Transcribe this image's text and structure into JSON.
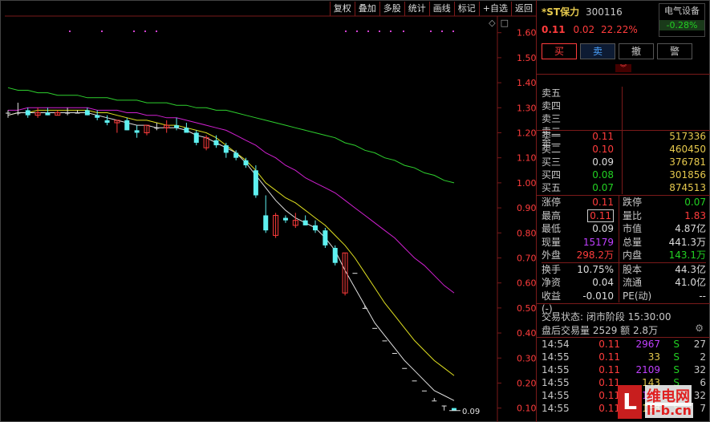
{
  "toolbar": {
    "buttons": [
      "复权",
      "叠加",
      "多股",
      "统计",
      "画线",
      "标记",
      "+自选",
      "返回"
    ],
    "icons": [
      "◇",
      "□"
    ]
  },
  "stock": {
    "name": "*ST保力",
    "code": "300116",
    "price": "0.11",
    "change": "0.02",
    "change_pct": "22.22%",
    "sector": "电气设备",
    "sector_pct": "-0.28%"
  },
  "trade_buttons": [
    "买",
    "卖",
    "撤",
    "警"
  ],
  "orderbook": {
    "sell": [
      {
        "label": "卖五",
        "price": "",
        "vol": ""
      },
      {
        "label": "卖四",
        "price": "",
        "vol": ""
      },
      {
        "label": "卖三",
        "price": "",
        "vol": ""
      },
      {
        "label": "卖二",
        "price": "",
        "vol": ""
      },
      {
        "label": "卖一",
        "price": "",
        "vol": ""
      }
    ],
    "buy": [
      {
        "label": "买一",
        "price": "0.11",
        "vol": "517336",
        "color": "red"
      },
      {
        "label": "买二",
        "price": "0.10",
        "vol": "460450",
        "color": "red"
      },
      {
        "label": "买三",
        "price": "0.09",
        "vol": "376781",
        "color": "white"
      },
      {
        "label": "买四",
        "price": "0.08",
        "vol": "301856",
        "color": "green"
      },
      {
        "label": "买五",
        "price": "0.07",
        "vol": "874513",
        "color": "green"
      }
    ]
  },
  "stats": [
    {
      "l1": "涨停",
      "v1": "0.11",
      "c1": "red",
      "l2": "跌停",
      "v2": "0.07",
      "c2": "green"
    },
    {
      "l1": "最高",
      "v1": "0.11",
      "c1": "red",
      "boxed": true,
      "l2": "量比",
      "v2": "1.83",
      "c2": "red"
    },
    {
      "l1": "最低",
      "v1": "0.09",
      "c1": "white",
      "l2": "市值",
      "v2": "4.87亿",
      "c2": "white"
    },
    {
      "l1": "现量",
      "v1": "15179",
      "c1": "purple",
      "l2": "总量",
      "v2": "441.3万",
      "c2": "white"
    },
    {
      "l1": "外盘",
      "v1": "298.2万",
      "c1": "red",
      "l2": "内盘",
      "v2": "143.1万",
      "c2": "green"
    },
    {
      "l1": "换手",
      "v1": "10.75%",
      "c1": "white",
      "l2": "股本",
      "v2": "44.3亿",
      "c2": "white"
    },
    {
      "l1": "净资",
      "v1": "0.04",
      "c1": "white",
      "l2": "流通",
      "v2": "41.0亿",
      "c2": "white"
    },
    {
      "l1": "收益(-)",
      "v1": "-0.010",
      "c1": "white",
      "l2": "PE(动)",
      "v2": "--",
      "c2": "white"
    }
  ],
  "status": {
    "line1": "交易状态: 闭市阶段 15:30:00",
    "line2": "盘后交易量 2529 额 2.8万"
  },
  "ticks": [
    {
      "t": "14:54",
      "p": "0.11",
      "v": "2967",
      "vc": "purple",
      "s": "S",
      "n": "27"
    },
    {
      "t": "14:55",
      "p": "0.11",
      "v": "33",
      "vc": "yellow",
      "s": "S",
      "n": "2"
    },
    {
      "t": "14:55",
      "p": "0.11",
      "v": "2109",
      "vc": "purple",
      "s": "S",
      "n": "32"
    },
    {
      "t": "14:55",
      "p": "0.11",
      "v": "143",
      "vc": "yellow",
      "s": "S",
      "n": "6"
    },
    {
      "t": "14:55",
      "p": "0.11",
      "v": "2168",
      "vc": "purple",
      "s": "S",
      "n": "32"
    },
    {
      "t": "14:55",
      "p": "0.11",
      "v": "158",
      "vc": "yellow",
      "s": "S",
      "n": "7"
    }
  ],
  "watermark": {
    "logo": "L",
    "line1": "维电网",
    "line2": "li-b.cn"
  },
  "chart_data": {
    "type": "candlestick",
    "y_ticks": [
      "1.60",
      "1.50",
      "1.40",
      "1.30",
      "1.20",
      "1.10",
      "1.00",
      "0.90",
      "0.80",
      "0.70",
      "0.60",
      "0.50",
      "0.40",
      "0.30",
      "0.20",
      "0.10"
    ],
    "ylim": [
      0.07,
      1.66
    ],
    "last_label": "0.09",
    "candles": [
      [
        1.28,
        1.29,
        1.26,
        1.28
      ],
      [
        1.28,
        1.32,
        1.27,
        1.28
      ],
      [
        1.29,
        1.3,
        1.26,
        1.27
      ],
      [
        1.27,
        1.3,
        1.26,
        1.28
      ],
      [
        1.28,
        1.3,
        1.27,
        1.27
      ],
      [
        1.27,
        1.29,
        1.27,
        1.28
      ],
      [
        1.28,
        1.3,
        1.27,
        1.28
      ],
      [
        1.28,
        1.29,
        1.28,
        1.28
      ],
      [
        1.29,
        1.3,
        1.27,
        1.27
      ],
      [
        1.27,
        1.29,
        1.25,
        1.26
      ],
      [
        1.25,
        1.27,
        1.23,
        1.24
      ],
      [
        1.24,
        1.25,
        1.2,
        1.25
      ],
      [
        1.25,
        1.26,
        1.21,
        1.21
      ],
      [
        1.21,
        1.23,
        1.18,
        1.2
      ],
      [
        1.2,
        1.23,
        1.19,
        1.23
      ],
      [
        1.22,
        1.24,
        1.21,
        1.22
      ],
      [
        1.22,
        1.25,
        1.2,
        1.23
      ],
      [
        1.23,
        1.26,
        1.21,
        1.22
      ],
      [
        1.22,
        1.24,
        1.2,
        1.2
      ],
      [
        1.2,
        1.21,
        1.15,
        1.16
      ],
      [
        1.14,
        1.19,
        1.13,
        1.18
      ],
      [
        1.17,
        1.19,
        1.14,
        1.15
      ],
      [
        1.15,
        1.16,
        1.1,
        1.12
      ],
      [
        1.12,
        1.13,
        1.09,
        1.1
      ],
      [
        1.09,
        1.1,
        1.06,
        1.07
      ],
      [
        1.05,
        1.07,
        0.94,
        0.95
      ],
      [
        0.87,
        0.95,
        0.8,
        0.81
      ],
      [
        0.79,
        0.88,
        0.78,
        0.87
      ],
      [
        0.86,
        0.87,
        0.84,
        0.85
      ],
      [
        0.83,
        0.88,
        0.82,
        0.85
      ],
      [
        0.85,
        0.87,
        0.83,
        0.83
      ],
      [
        0.83,
        0.85,
        0.8,
        0.81
      ],
      [
        0.81,
        0.82,
        0.74,
        0.75
      ],
      [
        0.74,
        0.75,
        0.67,
        0.68
      ],
      [
        0.56,
        0.72,
        0.55,
        0.72
      ],
      [
        0.64,
        0.64,
        0.64,
        0.64
      ],
      [
        0.5,
        0.51,
        0.5,
        0.5
      ],
      [
        0.42,
        0.42,
        0.42,
        0.42
      ],
      [
        0.37,
        0.37,
        0.37,
        0.37
      ],
      [
        0.32,
        0.32,
        0.32,
        0.32
      ],
      [
        0.26,
        0.26,
        0.26,
        0.26
      ],
      [
        0.21,
        0.21,
        0.21,
        0.21
      ],
      [
        0.17,
        0.17,
        0.17,
        0.17
      ],
      [
        0.13,
        0.14,
        0.13,
        0.13
      ],
      [
        0.11,
        0.11,
        0.09,
        0.11
      ],
      [
        0.1,
        0.1,
        0.09,
        0.09
      ]
    ],
    "ma_green": [
      1.38,
      1.37,
      1.37,
      1.36,
      1.36,
      1.35,
      1.35,
      1.35,
      1.34,
      1.34,
      1.34,
      1.33,
      1.33,
      1.33,
      1.32,
      1.32,
      1.32,
      1.31,
      1.31,
      1.3,
      1.3,
      1.29,
      1.29,
      1.28,
      1.27,
      1.26,
      1.25,
      1.24,
      1.23,
      1.22,
      1.21,
      1.2,
      1.19,
      1.18,
      1.16,
      1.15,
      1.13,
      1.12,
      1.1,
      1.09,
      1.07,
      1.06,
      1.04,
      1.03,
      1.01,
      1.0
    ],
    "ma_magenta": [
      1.29,
      1.29,
      1.3,
      1.3,
      1.3,
      1.3,
      1.3,
      1.3,
      1.3,
      1.29,
      1.29,
      1.29,
      1.28,
      1.28,
      1.27,
      1.27,
      1.26,
      1.26,
      1.25,
      1.24,
      1.23,
      1.22,
      1.21,
      1.19,
      1.17,
      1.15,
      1.12,
      1.1,
      1.07,
      1.05,
      1.02,
      1.0,
      0.98,
      0.96,
      0.93,
      0.9,
      0.87,
      0.84,
      0.81,
      0.78,
      0.74,
      0.7,
      0.67,
      0.63,
      0.59,
      0.56
    ],
    "ma_yellow": [
      1.27,
      1.28,
      1.28,
      1.29,
      1.29,
      1.29,
      1.29,
      1.29,
      1.29,
      1.28,
      1.28,
      1.27,
      1.26,
      1.25,
      1.25,
      1.24,
      1.23,
      1.23,
      1.22,
      1.21,
      1.2,
      1.18,
      1.15,
      1.12,
      1.09,
      1.05,
      1.0,
      0.97,
      0.94,
      0.92,
      0.89,
      0.86,
      0.83,
      0.79,
      0.75,
      0.7,
      0.64,
      0.58,
      0.52,
      0.47,
      0.42,
      0.37,
      0.33,
      0.29,
      0.26,
      0.23
    ],
    "ma_white": [
      1.27,
      1.28,
      1.28,
      1.28,
      1.28,
      1.28,
      1.28,
      1.28,
      1.28,
      1.27,
      1.26,
      1.25,
      1.24,
      1.23,
      1.23,
      1.22,
      1.22,
      1.22,
      1.21,
      1.19,
      1.18,
      1.16,
      1.14,
      1.12,
      1.08,
      1.03,
      0.98,
      0.93,
      0.89,
      0.86,
      0.84,
      0.82,
      0.78,
      0.73,
      0.65,
      0.58,
      0.51,
      0.44,
      0.39,
      0.34,
      0.29,
      0.25,
      0.21,
      0.17,
      0.15,
      0.13
    ],
    "markers_magenta_count": 8
  }
}
